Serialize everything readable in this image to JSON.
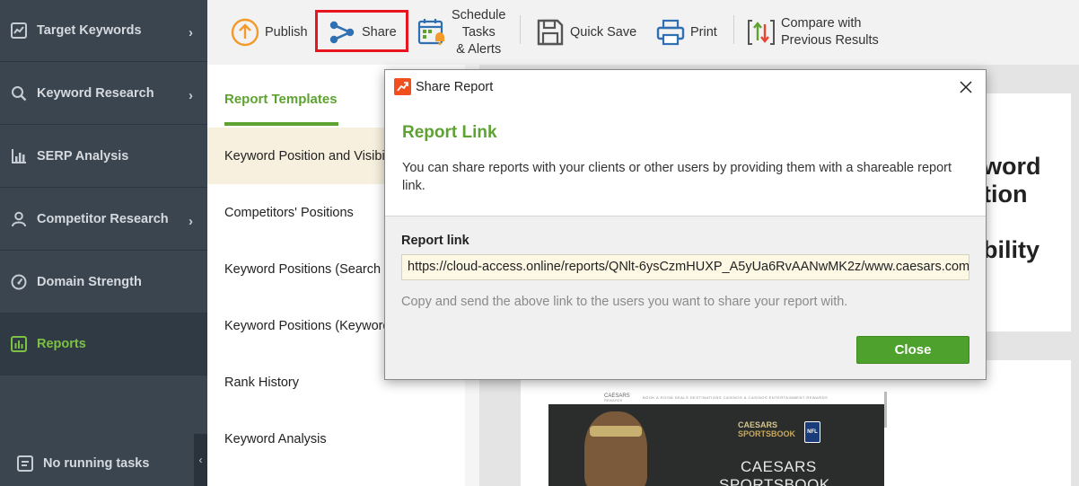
{
  "sidebar": {
    "items": [
      {
        "label": "Target Keywords",
        "icon": "chart-line-icon"
      },
      {
        "label": "Keyword Research",
        "icon": "search-icon"
      },
      {
        "label": "SERP Analysis",
        "icon": "bar-chart-icon"
      },
      {
        "label": "Competitor Research",
        "icon": "user-icon"
      },
      {
        "label": "Domain Strength",
        "icon": "gauge-icon"
      },
      {
        "label": "Reports",
        "icon": "reports-icon",
        "active": true
      }
    ],
    "tasks_label": "No running tasks",
    "collapse_glyph": "‹"
  },
  "toolbar": {
    "publish": "Publish",
    "share": "Share",
    "schedule_line1": "Schedule",
    "schedule_line2": "Tasks",
    "schedule_line3": "& Alerts",
    "quick_save": "Quick Save",
    "print": "Print",
    "compare_line1": "Compare with",
    "compare_line2": "Previous Results"
  },
  "templates": {
    "heading": "Report Templates",
    "items": [
      "Keyword Position and Visibility",
      "Competitors' Positions",
      "Keyword Positions (Search Engines)",
      "Keyword Positions (Keyword Groups)",
      "Rank History",
      "Keyword Analysis"
    ]
  },
  "preview": {
    "title_fragments": [
      "word",
      "tion",
      "bility"
    ],
    "shot": {
      "brand": "CAESARS",
      "brand_sub": "REWARDS",
      "menu": "BOOK A ROOM   DEALS   DESTINATIONS   CASINOS & CASINOS   ENTERTAINMENT   REWARDS",
      "logo_line1": "CAESARS",
      "logo_line2": "SPORTSBOOK",
      "nfl": "NFL",
      "title_line1": "CAESARS",
      "title_line2": "SPORTSBOOK"
    }
  },
  "dialog": {
    "title": "Share Report",
    "heading": "Report Link",
    "description": "You can share reports with your clients or other users by providing them with a shareable report link.",
    "link_label": "Report link",
    "link_value": "https://cloud-access.online/reports/QNlt-6ysCzmHUXP_A5yUa6RvAANwMK2z/www.caesars.com",
    "hint": "Copy and send the above link to the users you want to share your report with.",
    "close_button": "Close"
  },
  "colors": {
    "accent_green": "#5ea231",
    "button_green": "#4ea12c",
    "sidebar_bg": "#3a4550",
    "highlight_red": "#e8141f",
    "app_icon_orange": "#f24f1f"
  }
}
